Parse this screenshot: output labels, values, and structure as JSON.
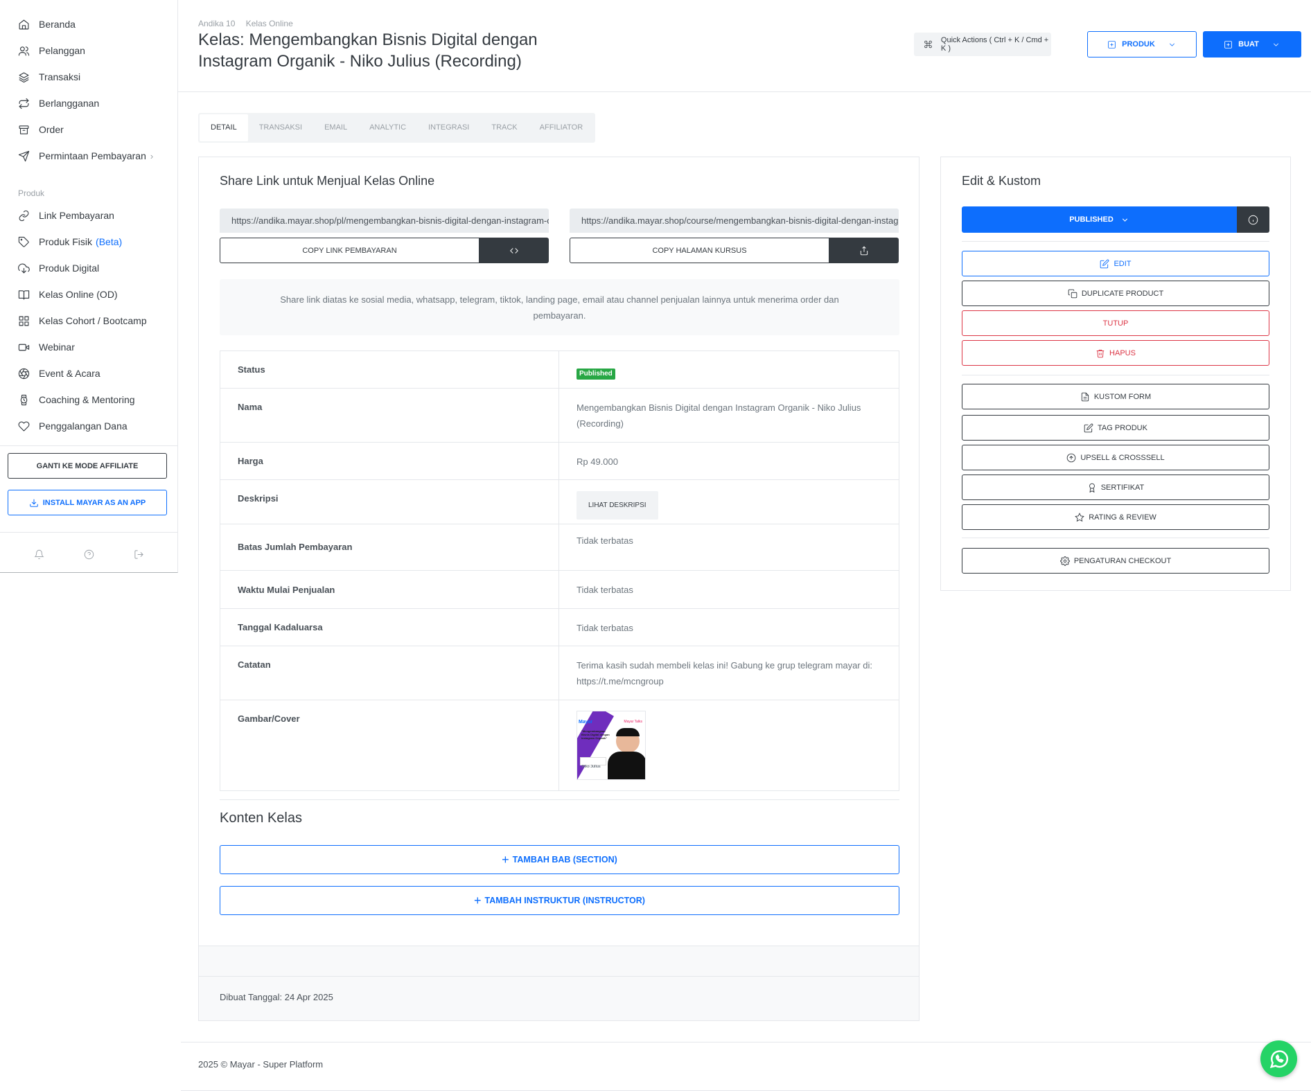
{
  "sidebar": {
    "items": [
      {
        "label": "Beranda",
        "icon": "home-icon"
      },
      {
        "label": "Pelanggan",
        "icon": "users-icon"
      },
      {
        "label": "Transaksi",
        "icon": "layers-icon"
      },
      {
        "label": "Berlangganan",
        "icon": "repeat-icon"
      },
      {
        "label": "Order",
        "icon": "box-icon"
      },
      {
        "label": "Permintaan Pembayaran",
        "icon": "send-icon"
      }
    ],
    "group_label": "Produk",
    "product_items": [
      {
        "label": "Link Pembayaran",
        "icon": "link-icon"
      },
      {
        "label": "Produk Fisik",
        "icon": "tag-icon",
        "badge": "(Beta)"
      },
      {
        "label": "Produk Digital",
        "icon": "cloud-download-icon"
      },
      {
        "label": "Kelas Online (OD)",
        "icon": "book-icon"
      },
      {
        "label": "Kelas Cohort / Bootcamp",
        "icon": "grid-icon"
      },
      {
        "label": "Webinar",
        "icon": "video-icon"
      },
      {
        "label": "Event & Acara",
        "icon": "aperture-icon"
      },
      {
        "label": "Coaching & Mentoring",
        "icon": "watch-icon"
      },
      {
        "label": "Penggalangan Dana",
        "icon": "heart-icon"
      }
    ],
    "affiliate_button": "GANTI KE MODE AFFILIATE",
    "install_button": "INSTALL MAYAR AS AN APP"
  },
  "header": {
    "breadcrumb": [
      "Andika 10",
      "Kelas Online"
    ],
    "title": "Kelas: Mengembangkan Bisnis Digital dengan Instagram Organik - Niko Julius (Recording)",
    "quick_actions": "Quick Actions ( Ctrl + K / Cmd + K )",
    "produk_button": "PRODUK",
    "buat_button": "BUAT"
  },
  "tabs": [
    "DETAIL",
    "TRANSAKSI",
    "EMAIL",
    "ANALYTIC",
    "INTEGRASI",
    "TRACK",
    "AFFILIATOR"
  ],
  "share": {
    "title": "Share Link untuk Menjual Kelas Online",
    "payment_link": "https://andika.mayar.shop/pl/mengembangkan-bisnis-digital-dengan-instagram-organik-niko-julius-recording",
    "course_link": "https://andika.mayar.shop/course/mengembangkan-bisnis-digital-dengan-instagram-organik-niko-julius-recording",
    "copy_payment": "COPY LINK PEMBAYARAN",
    "copy_course": "COPY HALAMAN KURSUS",
    "info": "Share link diatas ke sosial media, whatsapp, telegram, tiktok, landing page, email atau channel penjualan lainnya untuk menerima order dan pembayaran."
  },
  "details": {
    "status_label": "Status",
    "status_value": "Published",
    "nama_label": "Nama",
    "nama_value": "Mengembangkan Bisnis Digital dengan Instagram Organik - Niko Julius (Recording)",
    "harga_label": "Harga",
    "harga_value": "Rp 49.000",
    "deskripsi_label": "Deskripsi",
    "deskripsi_button": "LIHAT DESKRIPSI",
    "batas_label": "Batas Jumlah Pembayaran",
    "batas_value": "Tidak terbatas",
    "waktu_label": "Waktu Mulai Penjualan",
    "waktu_value": "Tidak terbatas",
    "kadaluarsa_label": "Tanggal Kadaluarsa",
    "kadaluarsa_value": "Tidak terbatas",
    "catatan_label": "Catatan",
    "catatan_value": "Terima kasih sudah membeli kelas ini! Gabung ke grup telegram mayar di: https://t.me/mcngroup",
    "gambar_label": "Gambar/Cover",
    "cover": {
      "brand": "Mayar",
      "tag": "Mayar Talks",
      "headline": "\"Mengembangkan Bisnis Digital dengan Instagram Organik\"",
      "name": "Niko Julius",
      "shirt": "YOUR"
    }
  },
  "konten": {
    "title": "Konten Kelas",
    "add_section": "TAMBAH BAB (SECTION)",
    "add_instructor": "TAMBAH INSTRUKTUR (INSTRUCTOR)"
  },
  "created": "Dibuat Tanggal: 24 Apr 2025",
  "edit_panel": {
    "title": "Edit & Kustom",
    "published": "PUBLISHED",
    "edit": "EDIT",
    "duplicate": "DUPLICATE PRODUCT",
    "tutup": "TUTUP",
    "hapus": "HAPUS",
    "kustom_form": "KUSTOM FORM",
    "tag_produk": "TAG PRODUK",
    "upsell": "UPSELL & CROSSSELL",
    "sertifikat": "SERTIFIKAT",
    "rating": "RATING & REVIEW",
    "checkout": "PENGATURAN CHECKOUT"
  },
  "footer": "2025 © Mayar - Super Platform",
  "colors": {
    "primary": "#0d6efd",
    "dark": "#343a40",
    "danger": "#dc3545",
    "success": "#28a745",
    "whatsapp": "#25d366"
  }
}
